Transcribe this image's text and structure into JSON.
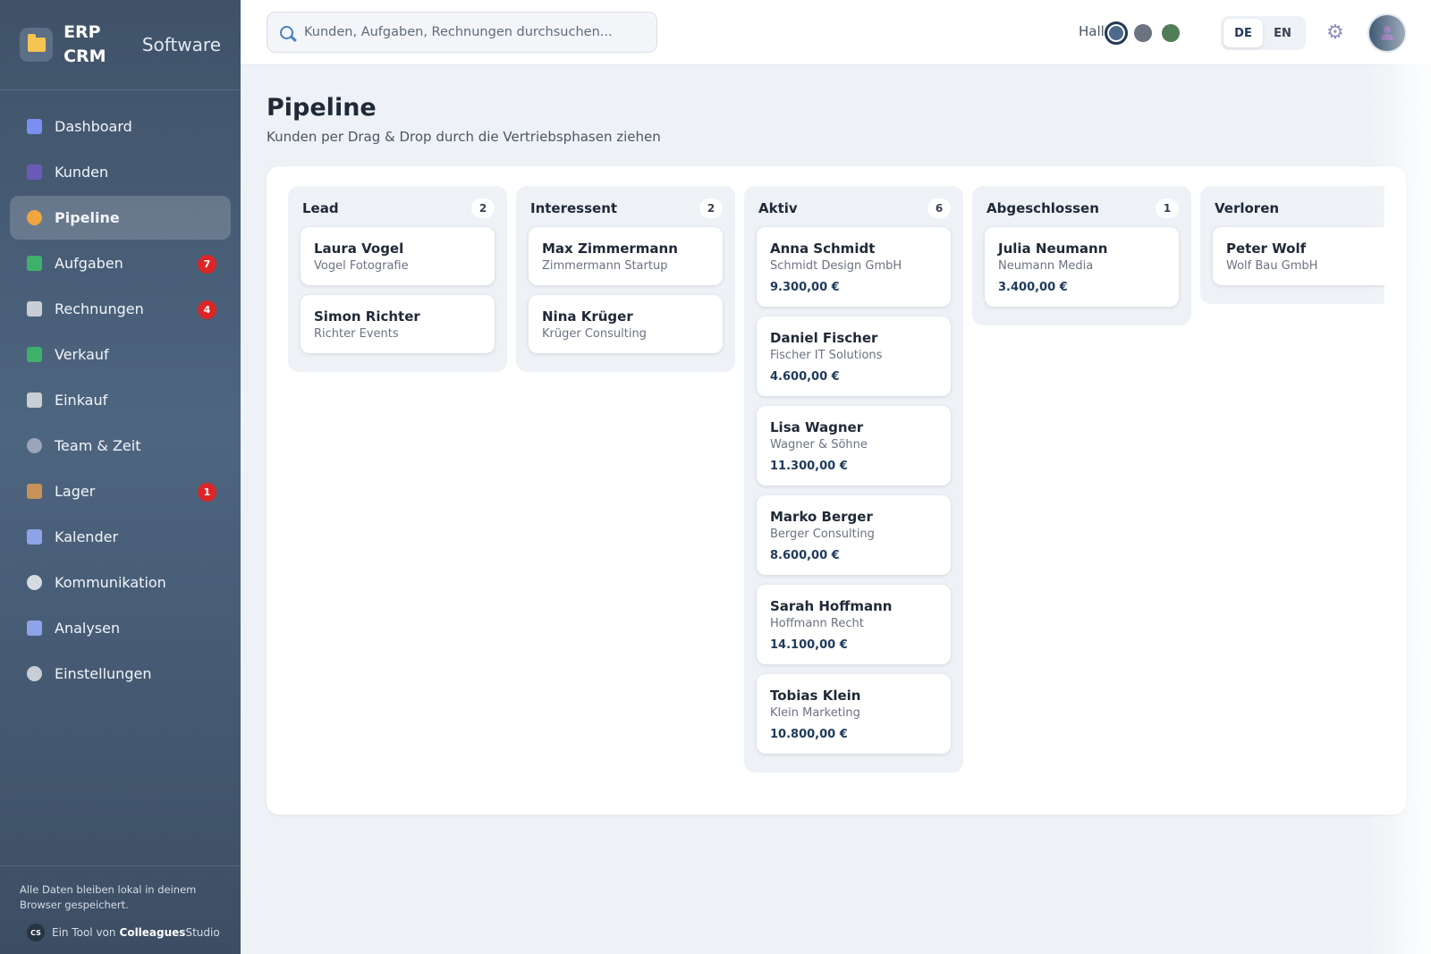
{
  "brand": {
    "name": "ERP CRM",
    "subtitle": "Software"
  },
  "sidebar": {
    "items": [
      {
        "id": "dashboard",
        "label": "Dashboard",
        "icon": "bar-chart-icon",
        "color": "#7b8ff0",
        "badge": null,
        "active": false
      },
      {
        "id": "kunden",
        "label": "Kunden",
        "icon": "users-icon",
        "color": "#6b5bb8",
        "badge": null,
        "active": false
      },
      {
        "id": "pipeline",
        "label": "Pipeline",
        "icon": "compass-icon",
        "color": "#f0a640",
        "badge": null,
        "active": true
      },
      {
        "id": "aufgaben",
        "label": "Aufgaben",
        "icon": "checkbox-icon",
        "color": "#3fb06b",
        "badge": "7",
        "active": false
      },
      {
        "id": "rechnungen",
        "label": "Rechnungen",
        "icon": "receipt-icon",
        "color": "#c9ced6",
        "badge": "4",
        "active": false
      },
      {
        "id": "verkauf",
        "label": "Verkauf",
        "icon": "trend-up-icon",
        "color": "#3fb06b",
        "badge": null,
        "active": false
      },
      {
        "id": "einkauf",
        "label": "Einkauf",
        "icon": "cash-register-icon",
        "color": "#c9ced6",
        "badge": null,
        "active": false
      },
      {
        "id": "team",
        "label": "Team & Zeit",
        "icon": "stopwatch-icon",
        "color": "#9aa6b8",
        "badge": null,
        "active": false
      },
      {
        "id": "lager",
        "label": "Lager",
        "icon": "package-icon",
        "color": "#c8915a",
        "badge": "1",
        "active": false
      },
      {
        "id": "kalender",
        "label": "Kalender",
        "icon": "calendar-icon",
        "color": "#8fa3e8",
        "badge": null,
        "active": false
      },
      {
        "id": "kommunikation",
        "label": "Kommunikation",
        "icon": "speech-bubble-icon",
        "color": "#d6dbe3",
        "badge": null,
        "active": false
      },
      {
        "id": "analysen",
        "label": "Analysen",
        "icon": "line-chart-icon",
        "color": "#8fa3e8",
        "badge": null,
        "active": false
      },
      {
        "id": "einstellungen",
        "label": "Einstellungen",
        "icon": "gear-icon",
        "color": "#c9ced6",
        "badge": null,
        "active": false
      }
    ],
    "footer_note": "Alle Daten bleiben lokal in deinem Browser gespeichert.",
    "credit_prefix": "Ein Tool von",
    "credit_brand": "Colleagues",
    "credit_brand_suffix": "Studio",
    "credit_logo": "CS"
  },
  "topbar": {
    "search_placeholder": "Kunden, Aufgaben, Rechnungen durchsuchen...",
    "greeting": "Hallo!",
    "theme_colors": [
      "#4d6a8d",
      "#6b7280",
      "#4f7d57"
    ],
    "languages": [
      {
        "label": "DE",
        "active": true
      },
      {
        "label": "EN",
        "active": false
      }
    ]
  },
  "page": {
    "title": "Pipeline",
    "subtitle": "Kunden per Drag & Drop durch die Vertriebsphasen ziehen"
  },
  "pipeline": {
    "columns": [
      {
        "title": "Lead",
        "count": "2",
        "cards": [
          {
            "name": "Laura Vogel",
            "company": "Vogel Fotografie",
            "value": ""
          },
          {
            "name": "Simon Richter",
            "company": "Richter Events",
            "value": ""
          }
        ]
      },
      {
        "title": "Interessent",
        "count": "2",
        "cards": [
          {
            "name": "Max Zimmermann",
            "company": "Zimmermann Startup",
            "value": ""
          },
          {
            "name": "Nina Krüger",
            "company": "Krüger Consulting",
            "value": ""
          }
        ]
      },
      {
        "title": "Aktiv",
        "count": "6",
        "cards": [
          {
            "name": "Anna Schmidt",
            "company": "Schmidt Design GmbH",
            "value": "9.300,00 €"
          },
          {
            "name": "Daniel Fischer",
            "company": "Fischer IT Solutions",
            "value": "4.600,00 €"
          },
          {
            "name": "Lisa Wagner",
            "company": "Wagner & Söhne",
            "value": "11.300,00 €"
          },
          {
            "name": "Marko Berger",
            "company": "Berger Consulting",
            "value": "8.600,00 €"
          },
          {
            "name": "Sarah Hoffmann",
            "company": "Hoffmann Recht",
            "value": "14.100,00 €"
          },
          {
            "name": "Tobias Klein",
            "company": "Klein Marketing",
            "value": "10.800,00 €"
          }
        ]
      },
      {
        "title": "Abgeschlossen",
        "count": "1",
        "cards": [
          {
            "name": "Julia Neumann",
            "company": "Neumann Media",
            "value": "3.400,00 €"
          }
        ]
      },
      {
        "title": "Verloren",
        "count": "",
        "cards": [
          {
            "name": "Peter Wolf",
            "company": "Wolf Bau GmbH",
            "value": ""
          }
        ]
      }
    ]
  }
}
